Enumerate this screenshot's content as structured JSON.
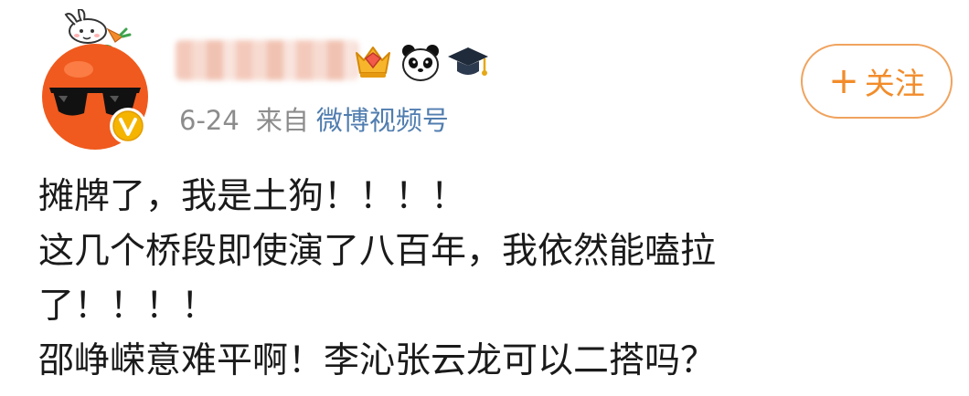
{
  "post": {
    "meta": {
      "date": "6-24",
      "from_label": "来自",
      "source": "微博视频号"
    },
    "follow_button": {
      "plus": "+",
      "label": "关注"
    },
    "content": {
      "lines": [
        "摊牌了，我是土狗！！！！",
        "这几个桥段即使演了八百年，我依然能嗑拉",
        "了！！！！",
        "邵峥嵘意难平啊！李沁张云龙可以二搭吗？"
      ]
    },
    "badges": [
      "crown-badge-icon",
      "panda-icon",
      "graduation-cap-icon"
    ],
    "avatar": {
      "description_icons": [
        "rabbit-icon",
        "carrot-icon",
        "orange-character",
        "sunglasses",
        "verified-v-icon"
      ]
    },
    "colors": {
      "meta_gray": "#8c8c8c",
      "source_blue": "#507daf",
      "follow_orange": "#f28c2a",
      "follow_border": "#f0a35e",
      "verified_gold": "#f5b400",
      "avatar_orange": "#f05a1e"
    }
  }
}
